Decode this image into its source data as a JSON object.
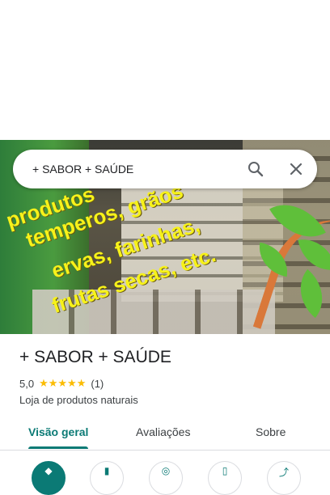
{
  "search": {
    "query": "+ SABOR + SAÚDE"
  },
  "hero_text": {
    "line1": "produtos",
    "line2": "temperos, grãos",
    "line3": "ervas, farinhas,",
    "line4": "frutas secas, etc."
  },
  "place": {
    "title": "+ SABOR + SAÚDE",
    "rating": "5,0",
    "stars": "★★★★★",
    "review_count": "(1)",
    "category": "Loja de produtos naturais"
  },
  "tabs": [
    {
      "label": "Visão geral",
      "active": true
    },
    {
      "label": "Avaliações",
      "active": false
    },
    {
      "label": "Sobre",
      "active": false
    }
  ],
  "actions": [
    {
      "icon": "directions-icon"
    },
    {
      "icon": "bookmark-icon"
    },
    {
      "icon": "nearby-icon"
    },
    {
      "icon": "phone-icon"
    },
    {
      "icon": "share-icon"
    }
  ],
  "colors": {
    "accent": "#0b7a75",
    "star": "#fbbc04",
    "promo_text": "#f7f21a"
  }
}
